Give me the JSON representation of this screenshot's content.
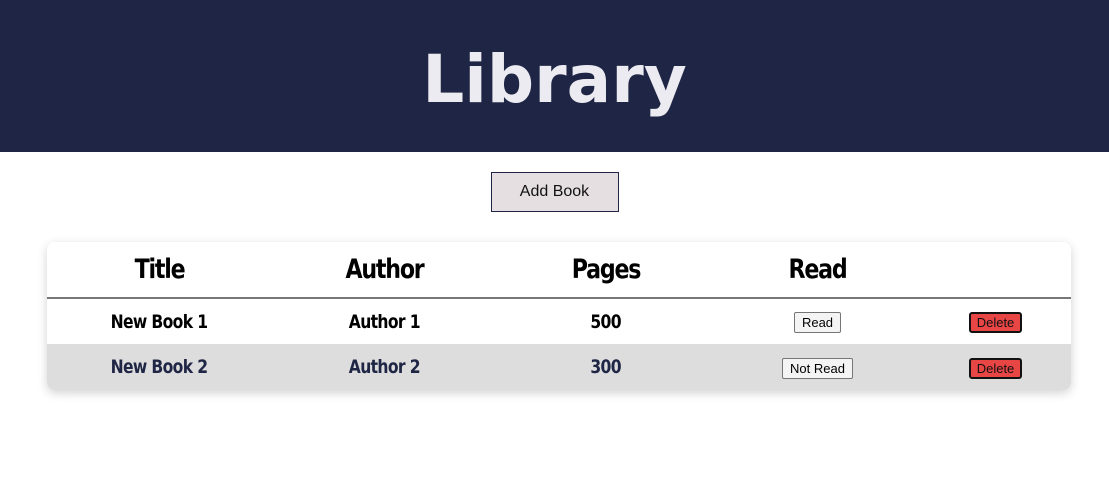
{
  "header": {
    "title": "Library"
  },
  "toolbar": {
    "add_book_label": "Add Book"
  },
  "table": {
    "columns": [
      "Title",
      "Author",
      "Pages",
      "Read",
      ""
    ],
    "rows": [
      {
        "title": "New Book 1",
        "author": "Author 1",
        "pages": "500",
        "read_label": "Read",
        "delete_label": "Delete"
      },
      {
        "title": "New Book 2",
        "author": "Author 2",
        "pages": "300",
        "read_label": "Not Read",
        "delete_label": "Delete"
      }
    ]
  },
  "colors": {
    "header_bg": "#1f2544",
    "header_text": "#ecebf2",
    "add_button_bg": "#e5dfe1",
    "delete_button_bg": "#e84545",
    "alt_row_bg": "#dddddd"
  }
}
